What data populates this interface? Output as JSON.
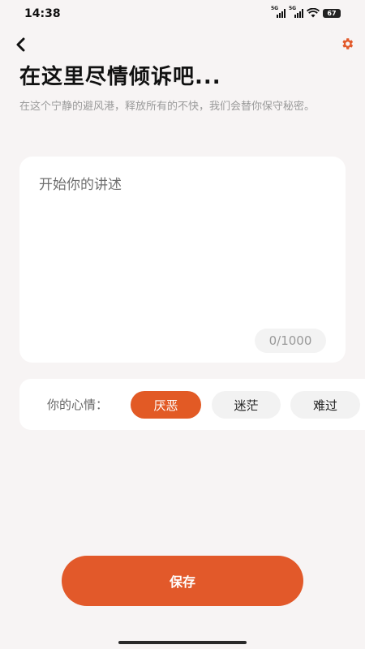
{
  "status_bar": {
    "time": "14:38",
    "network_1": "5G",
    "network_2": "5G",
    "battery": "67"
  },
  "header": {
    "back_icon": "chevron-left-icon",
    "settings_icon": "gear-icon",
    "title": "在这里尽情倾诉吧...",
    "subtitle": "在这个宁静的避风港，释放所有的不快，我们会替你保守秘密。"
  },
  "story": {
    "placeholder": "开始你的讲述",
    "value": "",
    "char_count": "0/1000"
  },
  "mood": {
    "label": "你的心情：",
    "options": [
      {
        "label": "厌恶",
        "selected": true
      },
      {
        "label": "迷茫",
        "selected": false
      },
      {
        "label": "难过",
        "selected": false
      }
    ]
  },
  "actions": {
    "save_label": "保存"
  },
  "colors": {
    "accent": "#e2592a",
    "background": "#f7f4f4",
    "card": "#ffffff"
  }
}
